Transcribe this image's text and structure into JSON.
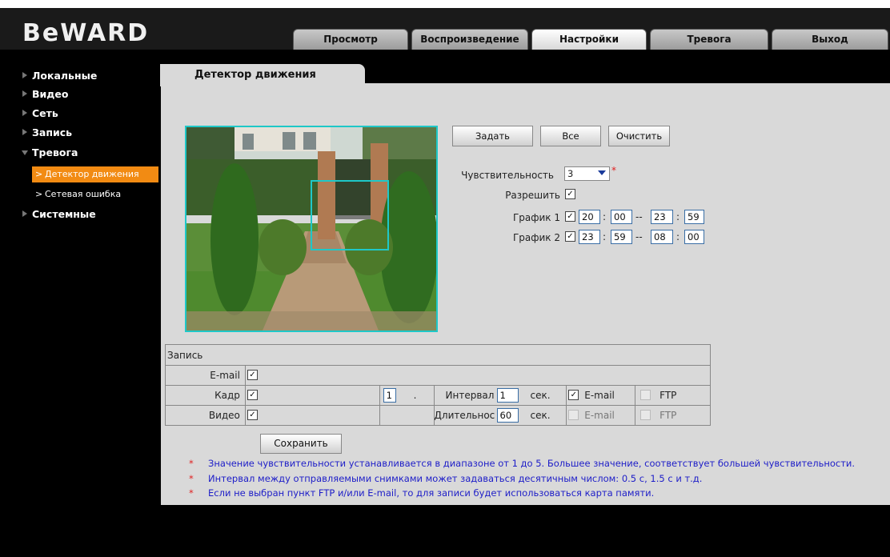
{
  "brand": {
    "logo_text": "BeWARD"
  },
  "top_tabs": [
    {
      "label": "Просмотр",
      "active": false
    },
    {
      "label": "Воспроизведение",
      "active": false
    },
    {
      "label": "Настройки",
      "active": true
    },
    {
      "label": "Тревога",
      "active": false
    },
    {
      "label": "Выход",
      "active": false
    }
  ],
  "sidebar": {
    "items": [
      {
        "label": "Локальные",
        "expanded": false
      },
      {
        "label": "Видео",
        "expanded": false
      },
      {
        "label": "Сеть",
        "expanded": false
      },
      {
        "label": "Запись",
        "expanded": false
      },
      {
        "label": "Тревога",
        "expanded": true
      },
      {
        "label": "Системные",
        "expanded": false
      }
    ],
    "subitems": [
      {
        "label": "Детектор движения",
        "active": true
      },
      {
        "label": "Сетевая ошибка",
        "active": false
      }
    ],
    "active_color": "#f28b13"
  },
  "section": {
    "title": "Детектор движения"
  },
  "region_buttons": {
    "set": "Задать",
    "all": "Все",
    "clear": "Очистить"
  },
  "settings": {
    "sensitivity_label": "Чувствительность",
    "sensitivity_value": "3",
    "required_mark": "*",
    "enable_label": "Разрешить",
    "enable_checked": true,
    "schedule1": {
      "label": "График 1",
      "checked": true,
      "h1": "20",
      "m1": "00",
      "h2": "23",
      "m2": "59"
    },
    "schedule2": {
      "label": "График 2",
      "checked": true,
      "h1": "23",
      "m1": "59",
      "h2": "08",
      "m2": "00"
    },
    "time_sep": ":",
    "range_sep": "--"
  },
  "record": {
    "header": "Запись",
    "email_label": "E-mail",
    "email_checked": true,
    "frame_label": "Кадр",
    "frame_checked": true,
    "frame_count": "1",
    "frame_dot": ".",
    "interval_label": "Интервал",
    "interval_value": "1",
    "interval_unit": "сек.",
    "frame_email_label": "E-mail",
    "frame_email_checked": true,
    "frame_ftp_label": "FTP",
    "frame_ftp_checked": false,
    "video_label": "Видео",
    "video_checked": true,
    "duration_label": "Длительнос",
    "duration_value": "60",
    "duration_unit": "сек.",
    "video_email_label": "E-mail",
    "video_email_checked": false,
    "video_ftp_label": "FTP",
    "video_ftp_checked": false
  },
  "save_button": "Сохранить",
  "notes": {
    "star": "*",
    "lines": [
      "Значение чувствительности устанавливается в диапазоне от 1 до 5. Большее значение, соответствует большей чувствительности.",
      "Интервал между отправляемыми снимками может задаваться десятичным числом: 0.5 с, 1.5 с и т.д.",
      "Если не выбран пункт FTP и/или E-mail, то для записи будет использоваться карта памяти."
    ]
  },
  "colors": {
    "region_frame": "#1ec8c8",
    "note_text": "#1d1dc8",
    "required": "#e02020"
  },
  "icons": {
    "checkmark": "✓",
    "submenu_chevron": ">"
  }
}
